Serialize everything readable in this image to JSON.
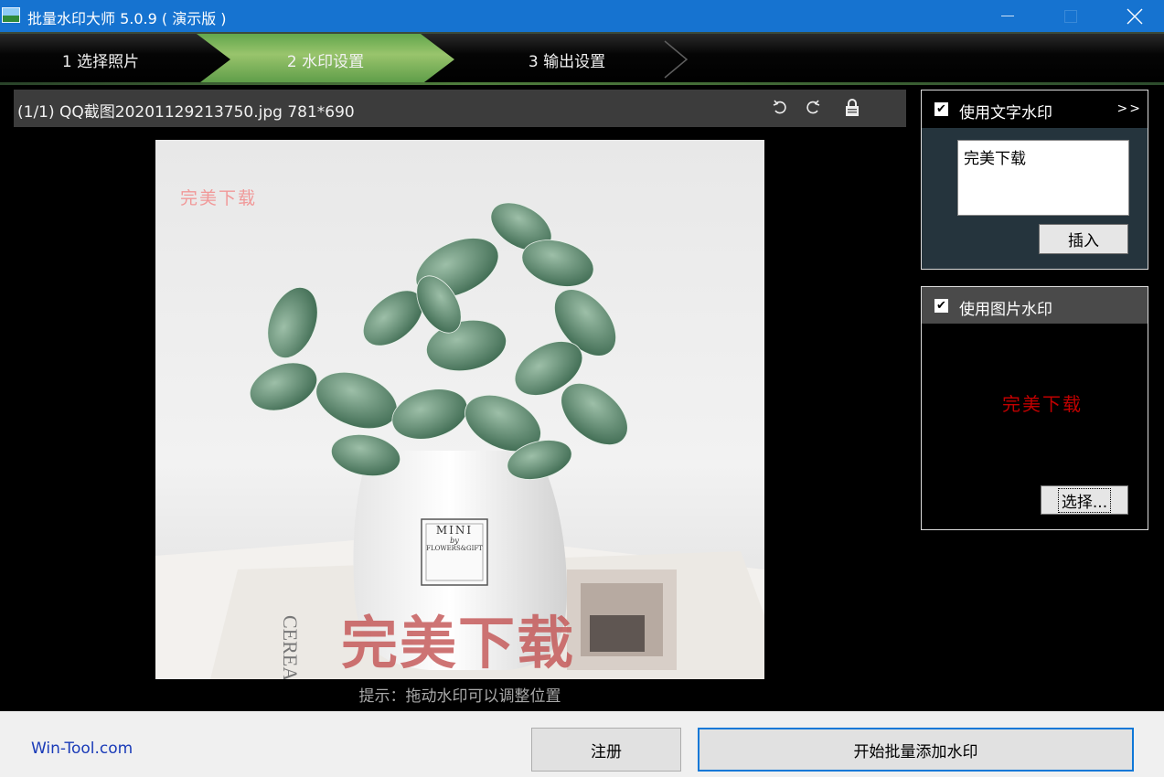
{
  "window": {
    "title": "批量水印大师 5.0.9 ( 演示版 )",
    "controls": {
      "minimize": "—",
      "maximize": "□",
      "close": "✕"
    }
  },
  "steps": [
    {
      "label": "1 选择照片",
      "active": false
    },
    {
      "label": "2 水印设置",
      "active": true
    },
    {
      "label": "3 输出设置",
      "active": false
    }
  ],
  "infobar": {
    "text": "(1/1) QQ截图20201129213750.jpg 781*690",
    "icons": [
      "rotate-left-icon",
      "rotate-right-icon",
      "lock-icon"
    ]
  },
  "preview": {
    "vase_label": {
      "line1": "MINI",
      "line2": "by",
      "line3": "FLOWERS&GIFT"
    },
    "watermark_small": "完美下载",
    "watermark_large": "完美下载",
    "hint": "提示：拖动水印可以调整位置"
  },
  "text_watermark": {
    "checked": true,
    "label": "使用文字水印",
    "more": ">>",
    "text": "完美下载",
    "insert_button": "插入"
  },
  "image_watermark": {
    "checked": true,
    "label": "使用图片水印",
    "preview_text": "完美下载",
    "choose_button": "选择..."
  },
  "footer": {
    "site": "Win-Tool.com",
    "register_button": "注册",
    "start_button": "开始批量添加水印"
  },
  "colors": {
    "titlebar": "#1673d0",
    "active_step": "#8bbf62",
    "watermark_red": "#c00000",
    "accent_border": "#0f78d7"
  }
}
